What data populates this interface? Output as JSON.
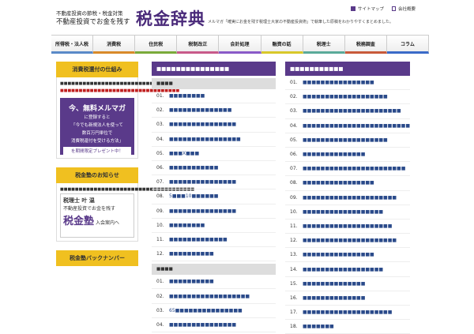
{
  "header": {
    "tagline1": "不動産投資の節税・税金対策",
    "tagline2": "不動産投資でお金を残す",
    "logo": "税金辞典",
    "sitemap": "サイトマップ",
    "company": "会社概要",
    "description": "メルマガ「確実にお金を残す税理士大家の不動産投資術」で執筆した原稿をわかりやすくまとめました。"
  },
  "nav": [
    "所得税・法人税",
    "消費税",
    "住民税",
    "税制改正",
    "会計処理",
    "融資の話",
    "税理士",
    "税務調査",
    "コラム"
  ],
  "sidebar": {
    "box1": {
      "title": "消費税還付の仕組み",
      "text": "■■■■■■■■■■■■■■■■■■■■■■■■■■■■■■■■■■",
      "red": "■■■■■■■■■■■■■■■■■■■■■■■■■■■■■■■■",
      "banner_main": "今、無料メルマガ",
      "banner_sub1": "に登録すると",
      "banner_sub2": "「今でも新規法人を使って",
      "banner_sub3": "数百万円単位で",
      "banner_sub4": "消費税還付を受ける方法」",
      "banner_line": "を期間限定プレゼント中！"
    },
    "box2": {
      "title": "税金塾のお知らせ",
      "text": "■■■■■■■■■■■■■■■■■■■■■■■■■■■■■■■■■■■■",
      "b2_title": "税理士 叶 温",
      "b2_main": "不動産投資でお金を残す",
      "b2_big": "税金塾",
      "b2_tail": "入会案内へ"
    },
    "box3": {
      "title": "税金塾バックナンバー"
    }
  },
  "main": {
    "head": "■■■■■■■■■■■■■■■",
    "sub1": "■■■■",
    "items1": [
      {
        "num": "01.",
        "text": "■■■■■■■■"
      },
      {
        "num": "02.",
        "text": "■■■■■■■■■■■■■■"
      },
      {
        "num": "03.",
        "text": "■■■■■■■■■■■■■■■"
      },
      {
        "num": "04.",
        "text": "■■■■■■■■■■■■■■■■"
      },
      {
        "num": "05.",
        "text": "■■■X■■■"
      },
      {
        "num": "06.",
        "text": "■■■■■■■■■■■"
      },
      {
        "num": "07.",
        "text": "■■■■■■■■■■■■■■■"
      },
      {
        "num": "08.",
        "text": "5■■■10■■■■■■"
      },
      {
        "num": "09.",
        "text": "■■■■■■■■■■■■■■■"
      },
      {
        "num": "10.",
        "text": "■■■■■■■■"
      },
      {
        "num": "11.",
        "text": "■■■■■■■■■■■■■"
      },
      {
        "num": "12.",
        "text": "■■■■■■■■■■"
      }
    ],
    "sub2": "■■■■",
    "items2": [
      {
        "num": "01.",
        "text": "■■■■■■■■■■"
      },
      {
        "num": "02.",
        "text": "■■■■■■■■■■■■■■■■■■"
      },
      {
        "num": "03.",
        "text": "65■■■■■■■■■■■■■■■"
      },
      {
        "num": "04.",
        "text": "■■■■■■■■■■■■■■■"
      }
    ]
  },
  "right": {
    "head": "■■■■■■■■■■■",
    "items": [
      {
        "num": "01.",
        "text": "■■■■■■■■■■■■■■■■"
      },
      {
        "num": "02.",
        "text": "■■■■■■■■■■■■■■■■■■■"
      },
      {
        "num": "03.",
        "text": "■■■■■■■■■■■■■■■■■■■■■■"
      },
      {
        "num": "04.",
        "text": "■■■■■■■■■■■■■■■■■■■■■■■■"
      },
      {
        "num": "05.",
        "text": "■■■■■■■■■■■■■■■■■■■"
      },
      {
        "num": "06.",
        "text": "■■■■■■■■■■■■■■"
      },
      {
        "num": "07.",
        "text": "■■■■■■■■■■■■■■■■■■■■■■■"
      },
      {
        "num": "08.",
        "text": "■■■■■■■■■■■■■■■■"
      },
      {
        "num": "09.",
        "text": "■■■■■■■■■■■■■■■■■■■■■"
      },
      {
        "num": "10.",
        "text": "■■■■■■■■■■■■■■■■■■"
      },
      {
        "num": "11.",
        "text": "■■■■■■■■■■■■■■■■■■■■"
      },
      {
        "num": "12.",
        "text": "■■■■■■■■■■■■■■■■■■■■■"
      },
      {
        "num": "13.",
        "text": "■■■■■■■■■■■■■■■■"
      },
      {
        "num": "14.",
        "text": "■■■■■■■■■■■■■■■■■■"
      },
      {
        "num": "15.",
        "text": "■■■■■■■■■■■■■■"
      },
      {
        "num": "16.",
        "text": "■■■■■■■■■■■■■■"
      },
      {
        "num": "17.",
        "text": "■■■■■■■■■■■■■■■■■■■■"
      },
      {
        "num": "18.",
        "text": "■■■■■■■"
      }
    ]
  }
}
